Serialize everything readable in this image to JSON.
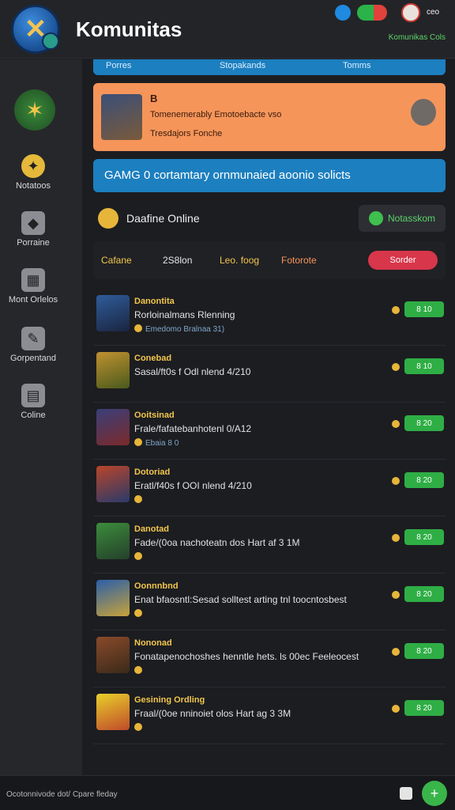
{
  "header": {
    "title": "Komunitas",
    "user": "ceo",
    "links": "Komunikas  Cols"
  },
  "sidebar": {
    "items": [
      {
        "label": "Notatoos",
        "icon": "medal-icon"
      },
      {
        "label": "Porraine",
        "icon": "puzzle-icon"
      },
      {
        "label": "Mont Orlelos",
        "icon": "store-icon"
      },
      {
        "label": "Gorpentand",
        "icon": "edit-icon"
      },
      {
        "label": "Coline",
        "icon": "server-icon"
      }
    ]
  },
  "main": {
    "top_bar": {
      "left": "Porres",
      "center": "Stopakands",
      "right": "Tomms"
    },
    "featured": {
      "line1": "B",
      "line2": "Tomenemerably Emotoebacte vso",
      "line3": "Tresdajors Fonche"
    },
    "banner": "GAMG 0 cortamtary ornmunaied aoonio solicts",
    "online": {
      "label": "Daafine Online",
      "notif_button": "Notasskom"
    },
    "filters": [
      {
        "label": "Cafane"
      },
      {
        "label": "2S8lon"
      },
      {
        "label": "Leo. foog"
      },
      {
        "label": "Fotorote"
      }
    ],
    "filter_chip": "Sorder",
    "rows": [
      {
        "title": "Danontita",
        "sub": "Rorloinalmans Rlenning",
        "meta": "Emedomo Bralnaa 31)",
        "badge": "8 10"
      },
      {
        "title": "Conebad",
        "sub": "Sasal/ft0s f Odl nlend 4/210",
        "meta": "",
        "badge": "8 10"
      },
      {
        "title": "Ooitsinad",
        "sub": "Frale/fafatebanhotenl 0/A12",
        "meta": "Ebaia 8 0",
        "badge": "8 20"
      },
      {
        "title": "Dotoriad",
        "sub": "Eratl/f40s f OOI nlend 4/210",
        "meta": "",
        "badge": "8 20"
      },
      {
        "title": "Danotad",
        "sub": "Fade/(0oa nachoteatn dos Hart af 3 1M",
        "meta": "",
        "badge": "8 20"
      },
      {
        "title": "Oonnnbnd",
        "sub": "Enat bfaosntl:Sesad solltest arting tnl toocntosbest",
        "meta": "",
        "badge": "8 20"
      },
      {
        "title": "Nononad",
        "sub": "Fonatapenochoshes henntle hets. ls 00ec Feeleocest",
        "meta": "",
        "badge": "8 20"
      },
      {
        "title": "Gesining Ordling",
        "sub": "Fraal/(0oe nninoiet olos Hart ag 3 3M",
        "meta": "",
        "badge": "8 20"
      }
    ]
  },
  "footer": {
    "text": "Ocotonnivode dot/ Cpare fleday"
  },
  "colors": {
    "accent": "#1c7fbf",
    "orange": "#f5955a",
    "green": "#2fae45"
  }
}
